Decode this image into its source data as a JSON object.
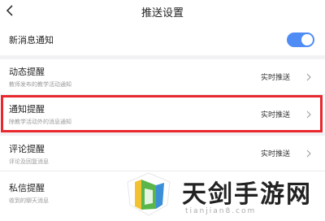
{
  "header": {
    "title": "推送设置",
    "back_icon": "chevron-left-icon"
  },
  "new_message": {
    "label": "新消息通知",
    "toggle_on": true,
    "toggle_color": "#4f8cf5"
  },
  "settings": [
    {
      "title": "动态提醒",
      "desc": "教师发布的教学活动通知",
      "value": "实时推送"
    },
    {
      "title": "通知提醒",
      "desc": "除教学活动外的消息通知",
      "value": "实时推送"
    },
    {
      "title": "评论提醒",
      "desc": "评论及回复消息",
      "value": "实时推送"
    },
    {
      "title": "私信提醒",
      "desc": "收到的聊天消息",
      "value": ""
    }
  ],
  "highlight_color": "#e8282e",
  "watermark": {
    "title": "天剑手游网",
    "subtitle": "tianjian8.com"
  }
}
